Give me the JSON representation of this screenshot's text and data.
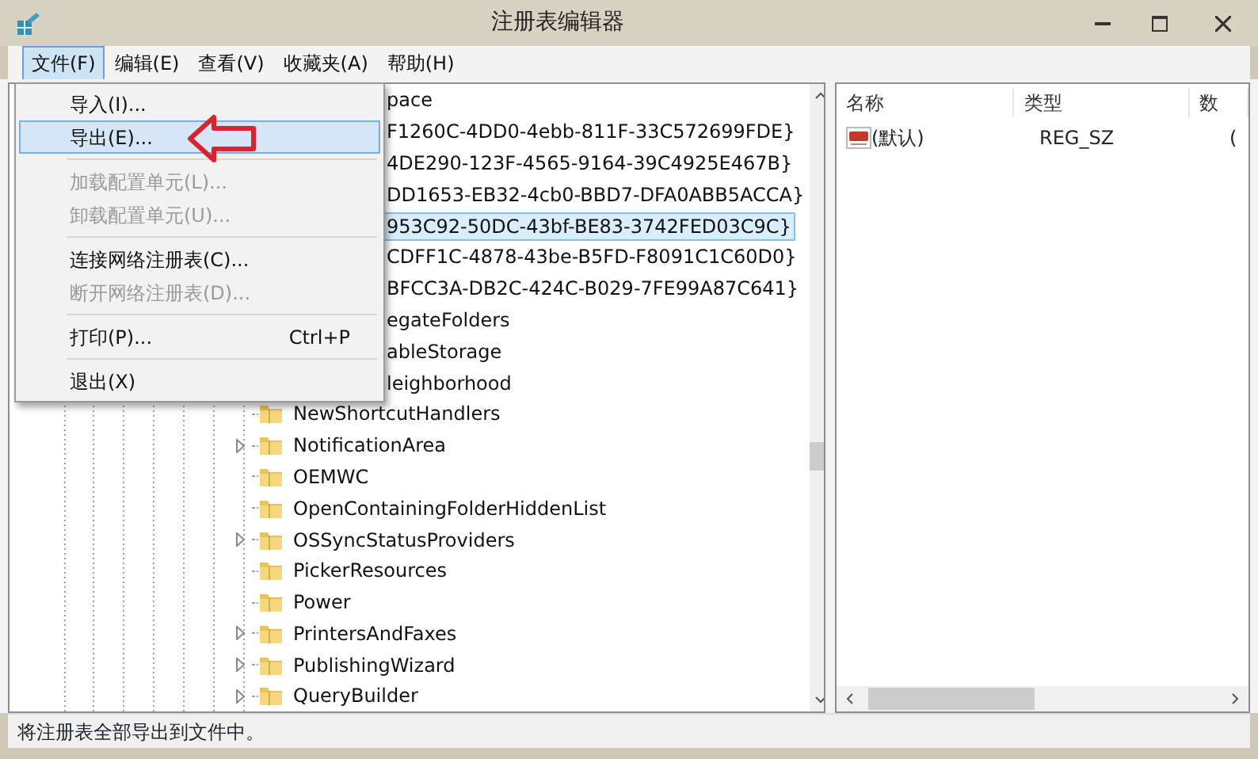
{
  "window": {
    "title": "注册表编辑器"
  },
  "menu_bar": [
    {
      "label": "文件(F)",
      "selected": true
    },
    {
      "label": "编辑(E)",
      "selected": false
    },
    {
      "label": "查看(V)",
      "selected": false
    },
    {
      "label": "收藏夹(A)",
      "selected": false
    },
    {
      "label": "帮助(H)",
      "selected": false
    }
  ],
  "file_menu": [
    {
      "kind": "item",
      "label": "导入(I)...",
      "selected": false,
      "disabled": false
    },
    {
      "kind": "item",
      "label": "导出(E)...",
      "selected": true,
      "disabled": false
    },
    {
      "kind": "separator"
    },
    {
      "kind": "item",
      "label": "加载配置单元(L)...",
      "selected": false,
      "disabled": true
    },
    {
      "kind": "item",
      "label": "卸载配置单元(U)...",
      "selected": false,
      "disabled": true
    },
    {
      "kind": "separator"
    },
    {
      "kind": "item",
      "label": "连接网络注册表(C)...",
      "selected": false,
      "disabled": false
    },
    {
      "kind": "item",
      "label": "断开网络注册表(D)...",
      "selected": false,
      "disabled": true
    },
    {
      "kind": "separator"
    },
    {
      "kind": "item",
      "label": "打印(P)...",
      "shortcut": "Ctrl+P",
      "selected": false,
      "disabled": false
    },
    {
      "kind": "separator"
    },
    {
      "kind": "item",
      "label": "退出(X)",
      "selected": false,
      "disabled": false
    }
  ],
  "tree": [
    {
      "kind": "covered",
      "label": "pace",
      "selected": false
    },
    {
      "kind": "covered",
      "label": "F1260C-4DD0-4ebb-811F-33C572699FDE}",
      "selected": false
    },
    {
      "kind": "covered",
      "label": "4DE290-123F-4565-9164-39C4925E467B}",
      "selected": false
    },
    {
      "kind": "covered",
      "label": "DD1653-EB32-4cb0-BBD7-DFA0ABB5ACCA}",
      "selected": false
    },
    {
      "kind": "covered",
      "label": "953C92-50DC-43bf-BE83-3742FED03C9C}",
      "selected": true
    },
    {
      "kind": "covered",
      "label": "CDFF1C-4878-43be-B5FD-F8091C1C60D0}",
      "selected": false
    },
    {
      "kind": "covered",
      "label": "BFCC3A-DB2C-424C-B029-7FE99A87C641}",
      "selected": false
    },
    {
      "kind": "covered",
      "label": "egateFolders",
      "selected": false
    },
    {
      "kind": "covered",
      "label": "ableStorage",
      "selected": false
    },
    {
      "kind": "covered",
      "label": "leighborhood",
      "selected": false
    },
    {
      "kind": "folder",
      "label": "NewShortcutHandlers",
      "expandable": false,
      "selected": false
    },
    {
      "kind": "folder",
      "label": "NotificationArea",
      "expandable": true,
      "selected": false
    },
    {
      "kind": "folder",
      "label": "OEMWC",
      "expandable": false,
      "selected": false
    },
    {
      "kind": "folder",
      "label": "OpenContainingFolderHiddenList",
      "expandable": false,
      "selected": false
    },
    {
      "kind": "folder",
      "label": "OSSyncStatusProviders",
      "expandable": true,
      "selected": false
    },
    {
      "kind": "folder",
      "label": "PickerResources",
      "expandable": false,
      "selected": false
    },
    {
      "kind": "folder",
      "label": "Power",
      "expandable": false,
      "selected": false
    },
    {
      "kind": "folder",
      "label": "PrintersAndFaxes",
      "expandable": true,
      "selected": false
    },
    {
      "kind": "folder",
      "label": "PublishingWizard",
      "expandable": true,
      "selected": false
    },
    {
      "kind": "folder",
      "label": "QueryBuilder",
      "expandable": true,
      "selected": false
    }
  ],
  "values_table": {
    "columns": [
      "名称",
      "类型",
      "数"
    ],
    "rows": [
      {
        "name": "(默认)",
        "type": "REG_SZ",
        "column_3": "("
      }
    ]
  },
  "status_bar": "将注册表全部导出到文件中。"
}
